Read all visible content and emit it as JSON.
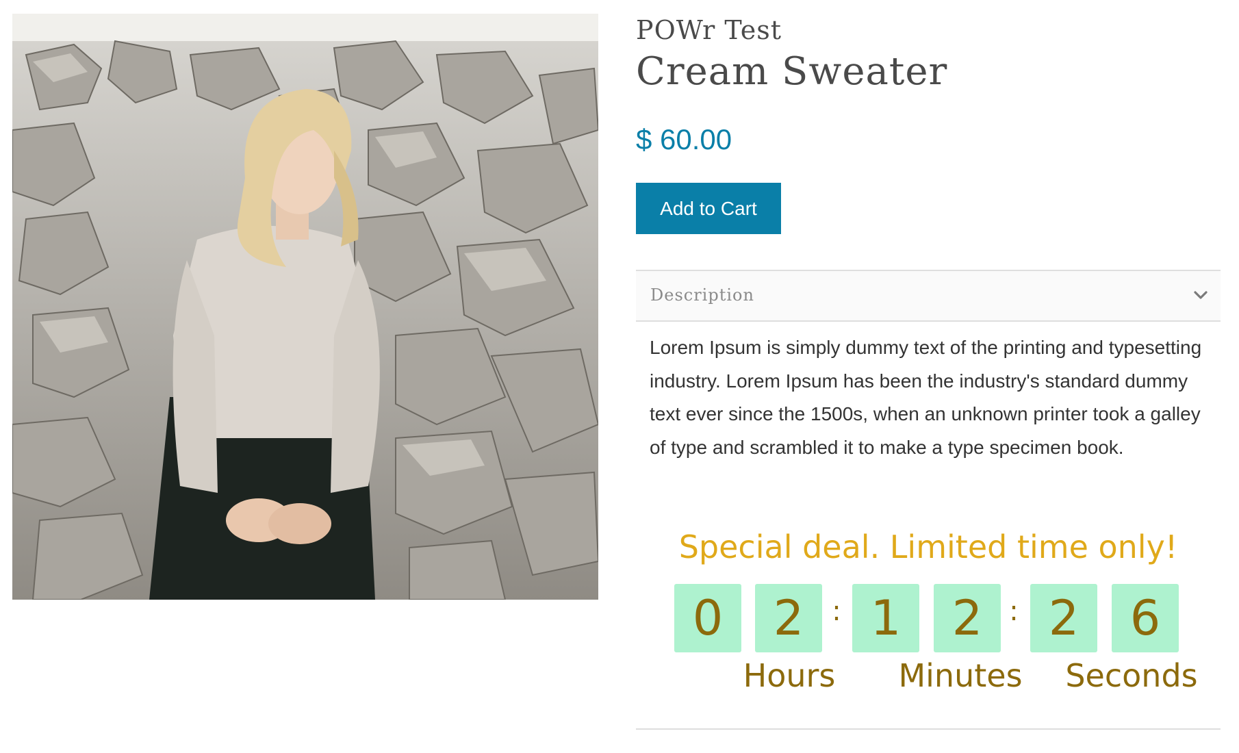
{
  "product": {
    "vendor": "POWr Test",
    "title": "Cream Sweater",
    "price": "$ 60.00",
    "add_to_cart_label": "Add to Cart",
    "image_alt": "Woman wearing a cream knit sweater standing in front of a pile of rocks"
  },
  "description": {
    "label": "Description",
    "text": "Lorem Ipsum is simply dummy text of the printing and typesetting industry. Lorem Ipsum has been the industry's standard dummy text ever since the 1500s, when an unknown printer took a galley of type and scrambled it to make a type specimen book.",
    "expand_icon": "chevron-down-icon"
  },
  "countdown": {
    "headline": "Special deal. Limited time only!",
    "hours_digits": [
      "0",
      "2"
    ],
    "minutes_digits": [
      "1",
      "2"
    ],
    "seconds_digits": [
      "2",
      "6"
    ],
    "separator": ":",
    "labels": {
      "hours": "Hours",
      "minutes": "Minutes",
      "seconds": "Seconds"
    }
  },
  "colors": {
    "accent_blue": "#0a7fa8",
    "deal_headline": "#e0a91a",
    "digit_background": "#aef2cf",
    "digit_text": "#8c6a0c"
  }
}
